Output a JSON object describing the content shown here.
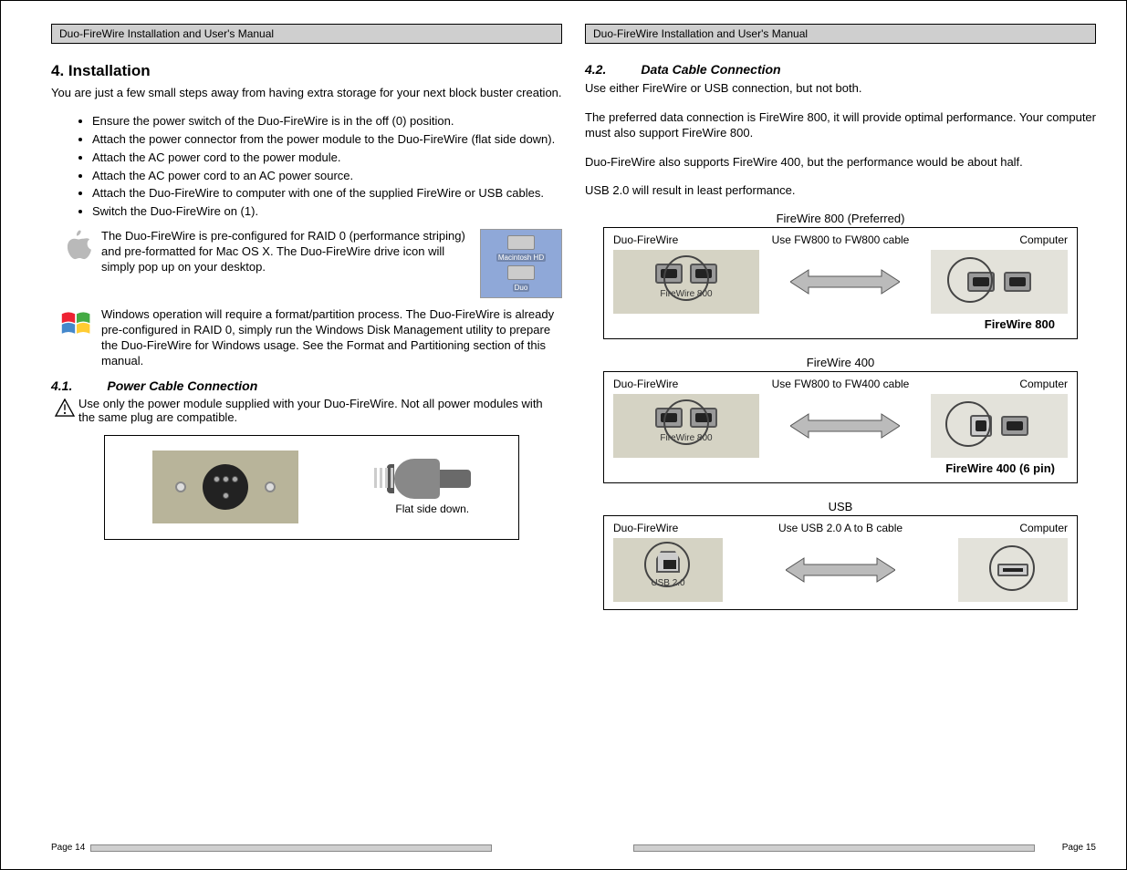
{
  "header": "Duo-FireWire Installation and User's Manual",
  "left": {
    "section_title": "4. Installation",
    "intro": "You are just a few small steps away from having extra storage for your next block buster creation.",
    "bullets": [
      "Ensure the power switch of the Duo-FireWire is in the off (0) position.",
      "Attach the power connector from the power module to the Duo-FireWire (flat side down).",
      "Attach the AC power cord to the power module.",
      "Attach the AC power cord to an AC power source.",
      "Attach the Duo-FireWire to computer with one of the supplied FireWire or USB cables.",
      "Switch the Duo-FireWire on (1)."
    ],
    "mac_text": "The Duo-FireWire is pre-configured for RAID 0 (performance striping) and pre-formatted for Mac OS X.  The Duo-FireWire drive icon will simply pop up on your desktop.",
    "desktop_labels": {
      "hd": "Macintosh HD",
      "duo": "Duo"
    },
    "win_text": "Windows operation will require a format/partition process.  The Duo-FireWire is already pre-configured in RAID 0, simply run the Windows Disk Management utility to prepare the Duo-FireWire for Windows usage.  See the Format and Partitioning section of this manual.",
    "sub41_num": "4.1.",
    "sub41_title": "Power Cable Connection",
    "sub41_text": "Use only the power module supplied with your Duo-FireWire.  Not all power modules with the same plug are compatible.",
    "flat_caption": "Flat side down."
  },
  "right": {
    "sub42_num": "4.2.",
    "sub42_title": "Data Cable Connection",
    "p1": "Use either FireWire or USB connection, but not both.",
    "p2": "The preferred data connection is FireWire 800, it will provide optimal performance.  Your computer must also support FireWire 800.",
    "p3": "Duo-FireWire also supports FireWire 400, but the performance would be about half.",
    "p4": "USB 2.0 will result in least performance.",
    "fw800": {
      "title": "FireWire 800 (Preferred)",
      "left_lbl": "Duo-FireWire",
      "mid_lbl": "Use FW800 to FW800 cable",
      "right_lbl": "Computer",
      "dev_caption": "FireWire 800",
      "caption": "FireWire 800"
    },
    "fw400": {
      "title": "FireWire 400",
      "left_lbl": "Duo-FireWire",
      "mid_lbl": "Use FW800 to FW400 cable",
      "right_lbl": "Computer",
      "dev_caption": "FireWire 800",
      "caption": "FireWire 400 (6 pin)"
    },
    "usb": {
      "title": "USB",
      "left_lbl": "Duo-FireWire",
      "mid_lbl": "Use USB 2.0 A to B cable",
      "right_lbl": "Computer",
      "dev_caption": "USB 2.0"
    }
  },
  "footer": {
    "left": "Page 14",
    "right": "Page 15"
  }
}
